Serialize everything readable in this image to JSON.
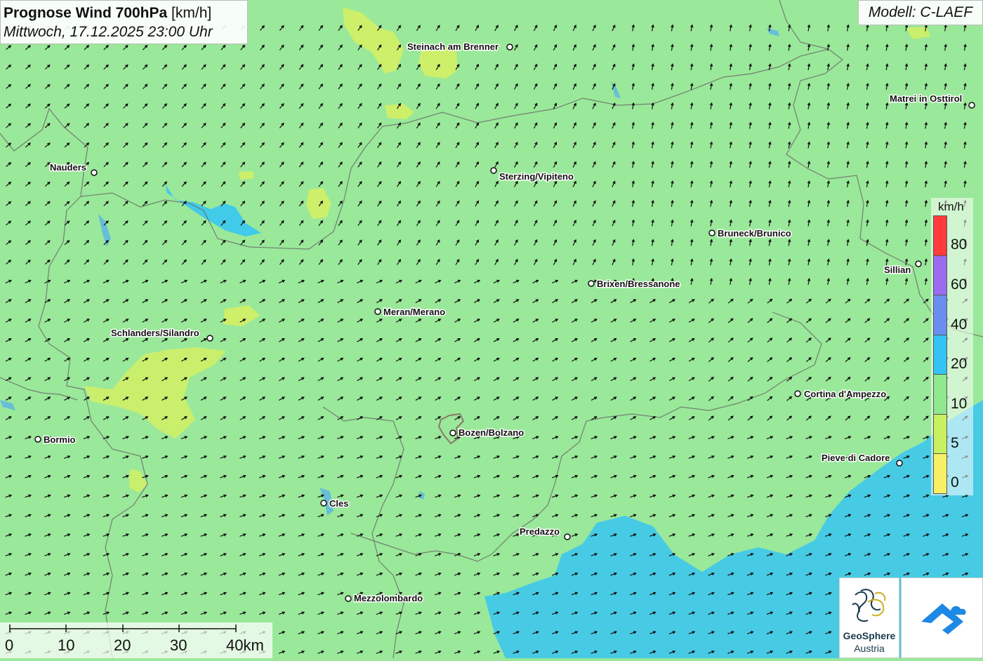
{
  "title": {
    "main_bold": "Prognose Wind 700hPa",
    "main_unit": " [km/h]",
    "subtitle": "Mittwoch, 17.12.2025 23:00 Uhr"
  },
  "model_label": "Modell: C-LAEF",
  "legend": {
    "unit": "km/h",
    "labels": [
      "80",
      "60",
      "40",
      "20",
      "10",
      "5",
      "0"
    ],
    "colors": [
      "#ff3b3b",
      "#9b6cf0",
      "#6a8ef0",
      "#33c3f5",
      "#8ee88e",
      "#c8f060",
      "#f7f064"
    ]
  },
  "scale_bar": {
    "labels": [
      "0",
      "10",
      "20",
      "30",
      "40km"
    ]
  },
  "cities": [
    {
      "name": "Steinach am Brenner"
    },
    {
      "name": "Matrei in Osttirol"
    },
    {
      "name": "Nauders"
    },
    {
      "name": "Sterzing/Vipiteno"
    },
    {
      "name": "Bruneck/Brunico"
    },
    {
      "name": "Sillian"
    },
    {
      "name": "Brixen/Bressanone"
    },
    {
      "name": "Meran/Merano"
    },
    {
      "name": "Schlanders/Silandro"
    },
    {
      "name": "Cortina d'Ampezzo"
    },
    {
      "name": "Bormio"
    },
    {
      "name": "Bozen/Bolzano"
    },
    {
      "name": "Pieve di Cadore"
    },
    {
      "name": "Cles"
    },
    {
      "name": "Predazzo"
    },
    {
      "name": "Mezzolombardo"
    }
  ],
  "logos": {
    "geosphere_line1": "GeoSphere",
    "geosphere_line2": "Austria"
  },
  "colors": {
    "wind_0_5": "#f7f064",
    "wind_5_10": "#c8f060",
    "wind_10_20": "#8ee88e",
    "wind_20_40": "#33c3f5",
    "wind_40_60": "#6a8ef0",
    "lake": "#5ab4e6"
  }
}
